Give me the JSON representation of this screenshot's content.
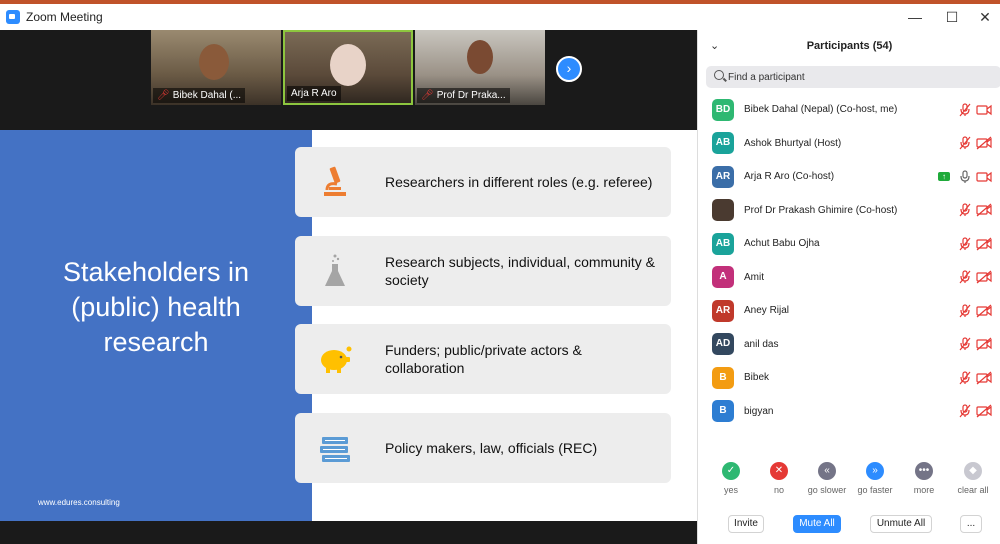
{
  "window": {
    "title": "Zoom Meeting",
    "controls": {
      "minimize": "—",
      "maximize": "☐",
      "close": "✕"
    }
  },
  "video_strip": {
    "tiles": [
      {
        "label": "Bibek Dahal (...",
        "mic_muted": true
      },
      {
        "label": "Arja R Aro",
        "mic_muted": false,
        "active_speaker": true
      },
      {
        "label": "Prof Dr Praka...",
        "mic_muted": true
      }
    ],
    "next_icon": "›"
  },
  "slide": {
    "title": "Stakeholders in (public) health research",
    "url": "www.edures.consulting",
    "cards": [
      {
        "icon": "microscope-icon",
        "text": "Researchers in different roles (e.g. referee)"
      },
      {
        "icon": "flask-icon",
        "text": "Research subjects, individual, community & society"
      },
      {
        "icon": "piggy-bank-icon",
        "text": "Funders; public/private actors & collaboration"
      },
      {
        "icon": "books-icon",
        "text": "Policy makers, law, officials (REC)"
      }
    ],
    "colors": {
      "left_panel": "#4472c4",
      "icon_orange": "#ed7d31",
      "icon_gray": "#a5a5a5",
      "icon_yellow": "#ffc000",
      "icon_blue": "#5b9bd5"
    }
  },
  "participants_panel": {
    "title": "Participants (54)",
    "collapse_icon": "⌄",
    "search_placeholder": "Find a participant",
    "participants": [
      {
        "initials": "BD",
        "name": "Bibek Dahal (Nepal) (Co-host, me)",
        "color": "#2eb872",
        "mic": "muted",
        "cam": "on"
      },
      {
        "initials": "AB",
        "name": "Ashok Bhurtyal (Host)",
        "color": "#1aa39a",
        "mic": "muted",
        "cam": "off"
      },
      {
        "initials": "AR",
        "name": "Arja R Aro (Co-host)",
        "color": "#3b6ea8",
        "mic": "on",
        "cam": "on",
        "sharing": true
      },
      {
        "initials": "",
        "name": "Prof Dr Prakash Ghimire (Co-host)",
        "color": "#4a3a30",
        "mic": "muted",
        "cam": "off",
        "photo": true
      },
      {
        "initials": "AB",
        "name": "Achut Babu Ojha",
        "color": "#1aa39a",
        "mic": "muted",
        "cam": "off"
      },
      {
        "initials": "A",
        "name": "Amit",
        "color": "#c2307a",
        "mic": "muted",
        "cam": "off"
      },
      {
        "initials": "AR",
        "name": "Aney Rijal",
        "color": "#c0392b",
        "mic": "muted",
        "cam": "off"
      },
      {
        "initials": "AD",
        "name": "anil das",
        "color": "#33485f",
        "mic": "muted",
        "cam": "off"
      },
      {
        "initials": "B",
        "name": "Bibek",
        "color": "#f39c12",
        "mic": "muted",
        "cam": "off"
      },
      {
        "initials": "B",
        "name": "bigyan",
        "color": "#2d7dd2",
        "mic": "muted",
        "cam": "off"
      }
    ],
    "reactions": [
      {
        "label": "yes",
        "glyph": "✓",
        "color": "#2eb872"
      },
      {
        "label": "no",
        "glyph": "✕",
        "color": "#e53935"
      },
      {
        "label": "go slower",
        "glyph": "«",
        "color": "#747487"
      },
      {
        "label": "go faster",
        "glyph": "»",
        "color": "#2d8cff"
      },
      {
        "label": "more",
        "glyph": "•••",
        "color": "#747487"
      },
      {
        "label": "clear all",
        "glyph": "◆",
        "color": "#c8c8d0"
      }
    ],
    "buttons": {
      "invite": "Invite",
      "mute_all": "Mute All",
      "unmute_all": "Unmute All",
      "more": "..."
    }
  }
}
